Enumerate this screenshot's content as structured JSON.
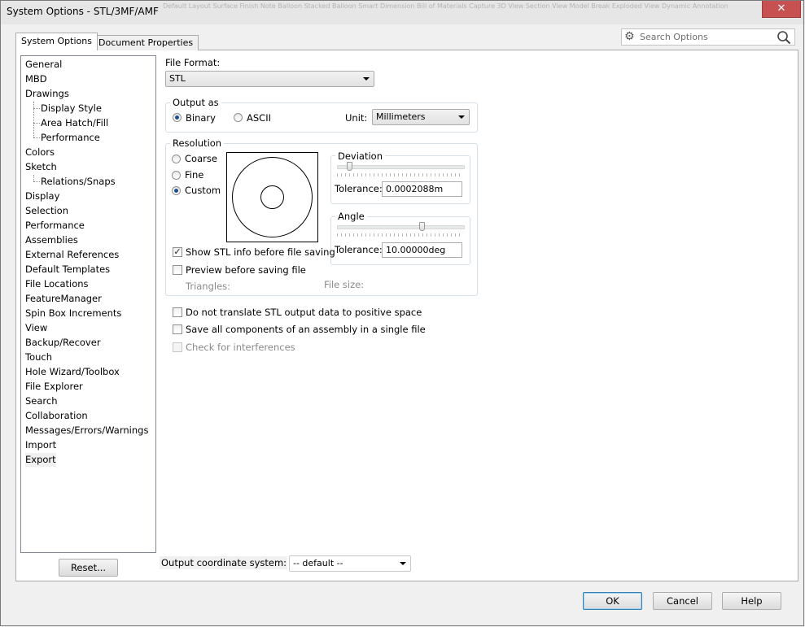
{
  "window": {
    "title": "System Options - STL/3MF/AMF",
    "close_glyph": "✕",
    "background_ribbon": "Default Layout   Surface Finish   Note Balloon   Stacked Balloon   Smart Dimension   Bill of Materials   Capture 3D View   Section View   Model Break   Exploded View   Dynamic Annotation"
  },
  "tabs": [
    {
      "label": "System Options"
    },
    {
      "label": "Document Properties"
    }
  ],
  "search": {
    "placeholder": "Search Options"
  },
  "nav": {
    "items": [
      {
        "label": "General"
      },
      {
        "label": "MBD"
      },
      {
        "label": "Drawings"
      },
      {
        "label": "Display Style"
      },
      {
        "label": "Area Hatch/Fill"
      },
      {
        "label": "Performance"
      },
      {
        "label": "Colors"
      },
      {
        "label": "Sketch"
      },
      {
        "label": "Relations/Snaps"
      },
      {
        "label": "Display"
      },
      {
        "label": "Selection"
      },
      {
        "label": "Performance"
      },
      {
        "label": "Assemblies"
      },
      {
        "label": "External References"
      },
      {
        "label": "Default Templates"
      },
      {
        "label": "File Locations"
      },
      {
        "label": "FeatureManager"
      },
      {
        "label": "Spin Box Increments"
      },
      {
        "label": "View"
      },
      {
        "label": "Backup/Recover"
      },
      {
        "label": "Touch"
      },
      {
        "label": "Hole Wizard/Toolbox"
      },
      {
        "label": "File Explorer"
      },
      {
        "label": "Search"
      },
      {
        "label": "Collaboration"
      },
      {
        "label": "Messages/Errors/Warnings"
      },
      {
        "label": "Import"
      },
      {
        "label": "Export"
      }
    ]
  },
  "file_format": {
    "label": "File Format:",
    "value": "STL"
  },
  "output_as": {
    "title": "Output as",
    "binary": "Binary",
    "ascii": "ASCII",
    "unit_label": "Unit:",
    "unit_value": "Millimeters"
  },
  "resolution": {
    "title": "Resolution",
    "coarse": "Coarse",
    "fine": "Fine",
    "custom": "Custom",
    "deviation": {
      "title": "Deviation",
      "tolerance_label": "Tolerance:",
      "tolerance_value": "0.0002088m",
      "level": 0.08
    },
    "angle": {
      "title": "Angle",
      "tolerance_label": "Tolerance:",
      "tolerance_value": "10.00000deg",
      "level": 0.68
    },
    "show_info": "Show STL info before file saving",
    "preview": "Preview before saving file",
    "triangles": "Triangles:",
    "file_size": "File size:"
  },
  "options": {
    "no_translate": "Do not translate STL output data to positive space",
    "save_all": "Save all components of an assembly in a single file",
    "check_interference": "Check for interferences"
  },
  "coordinate": {
    "label": "Output coordinate system:",
    "value": "-- default --"
  },
  "buttons": {
    "reset": "Reset...",
    "ok": "OK",
    "cancel": "Cancel",
    "help": "Help"
  }
}
